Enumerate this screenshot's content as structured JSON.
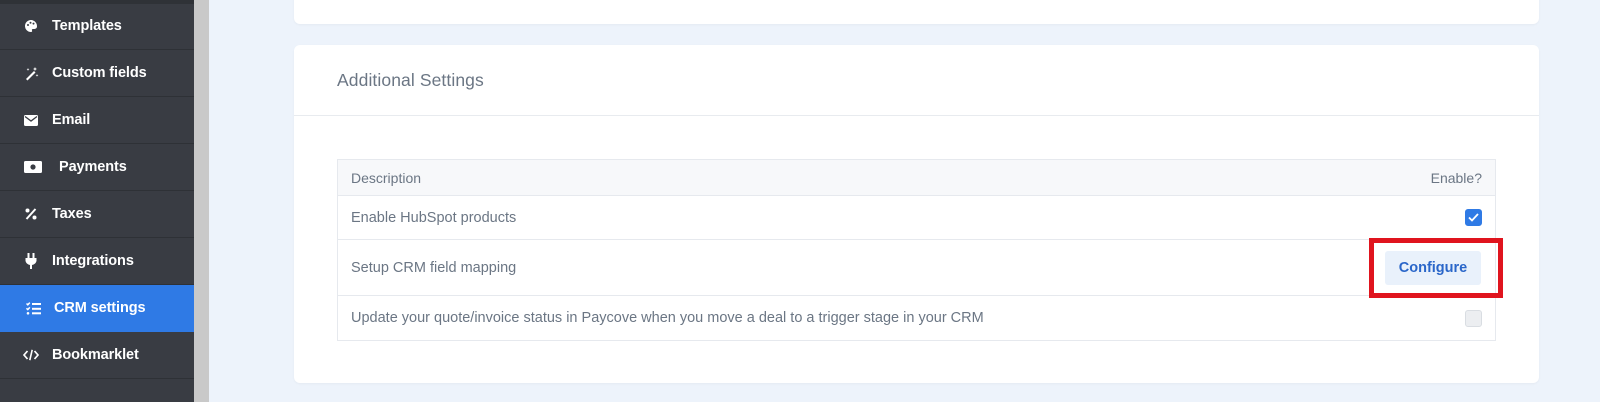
{
  "sidebar": {
    "items": [
      {
        "label": "Templates",
        "icon": "palette-icon"
      },
      {
        "label": "Custom fields",
        "icon": "magic-wand-icon"
      },
      {
        "label": "Email",
        "icon": "envelope-icon"
      },
      {
        "label": "Payments",
        "icon": "money-bill-icon"
      },
      {
        "label": "Taxes",
        "icon": "percent-icon"
      },
      {
        "label": "Integrations",
        "icon": "plug-icon"
      },
      {
        "label": "CRM settings",
        "icon": "list-check-icon",
        "active": true
      },
      {
        "label": "Bookmarklet",
        "icon": "code-icon"
      }
    ]
  },
  "additional_settings": {
    "title": "Additional Settings",
    "table": {
      "columns": [
        "Description",
        "Enable?"
      ],
      "rows": [
        {
          "description": "Enable HubSpot products",
          "control": "checkbox",
          "checked": true
        },
        {
          "description": "Setup CRM field mapping",
          "control": "button",
          "button_label": "Configure"
        },
        {
          "description": "Update your quote/invoice status in Paycove when you move a deal to a trigger stage in your CRM",
          "control": "checkbox",
          "checked": false
        }
      ]
    }
  },
  "colors": {
    "sidebar_bg": "#393c43",
    "active_item": "#2f7ae5",
    "page_bg": "#edf3fb",
    "highlight": "#e0141e"
  }
}
